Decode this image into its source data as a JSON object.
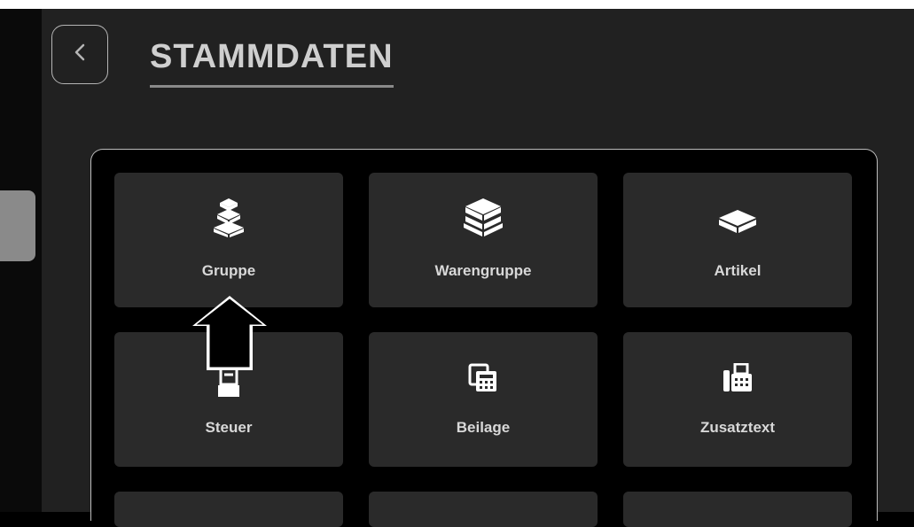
{
  "header": {
    "title": "STAMMDATEN"
  },
  "tiles": [
    {
      "label": "Gruppe",
      "icon": "stacked-boxes-icon"
    },
    {
      "label": "Warengruppe",
      "icon": "box-stack-icon"
    },
    {
      "label": "Artikel",
      "icon": "box-icon"
    },
    {
      "label": "Steuer",
      "icon": "cash-register-icon"
    },
    {
      "label": "Beilage",
      "icon": "calculator-copy-icon"
    },
    {
      "label": "Zusatztext",
      "icon": "fax-icon"
    },
    {
      "label": "",
      "icon": ""
    },
    {
      "label": "",
      "icon": ""
    },
    {
      "label": "",
      "icon": ""
    }
  ],
  "colors": {
    "background": "#212121",
    "tile": "#2a2a2a",
    "frame_background": "#000000",
    "text": "#d8d8d8",
    "title": "#cfcfcf"
  }
}
